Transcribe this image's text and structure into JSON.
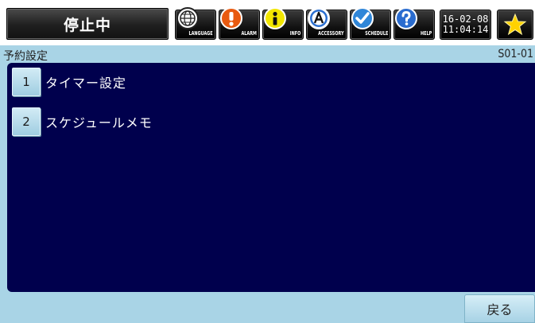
{
  "header": {
    "status": "停止中",
    "buttons": [
      {
        "label": "LANGUAGE",
        "icon": "globe-icon"
      },
      {
        "label": "ALARM",
        "icon": "alarm-icon"
      },
      {
        "label": "INFO",
        "icon": "info-icon"
      },
      {
        "label": "ACCESSORY",
        "icon": "accessory-icon"
      },
      {
        "label": "SCHEDULE",
        "icon": "checkmark-icon"
      },
      {
        "label": "HELP",
        "icon": "help-icon"
      }
    ],
    "clock": {
      "date": "16-02-08",
      "time": "11:04:14"
    },
    "favorite_icon": "star-icon"
  },
  "title": {
    "text": "予約設定",
    "code": "S01-01"
  },
  "menu": [
    {
      "number": "1",
      "label": "タイマー設定"
    },
    {
      "number": "2",
      "label": "スケジュールメモ"
    }
  ],
  "footer": {
    "back_label": "戻る"
  },
  "colors": {
    "screen_bg": "#a9d4e6",
    "panel_bg": "#00004d",
    "status_bg": "#1f1f1f",
    "alarm": "#e85a10",
    "info": "#f2e600",
    "accessory": "#2b6fd0",
    "schedule": "#2f86d8",
    "help": "#2a6ccf",
    "star": "#ffd200"
  }
}
